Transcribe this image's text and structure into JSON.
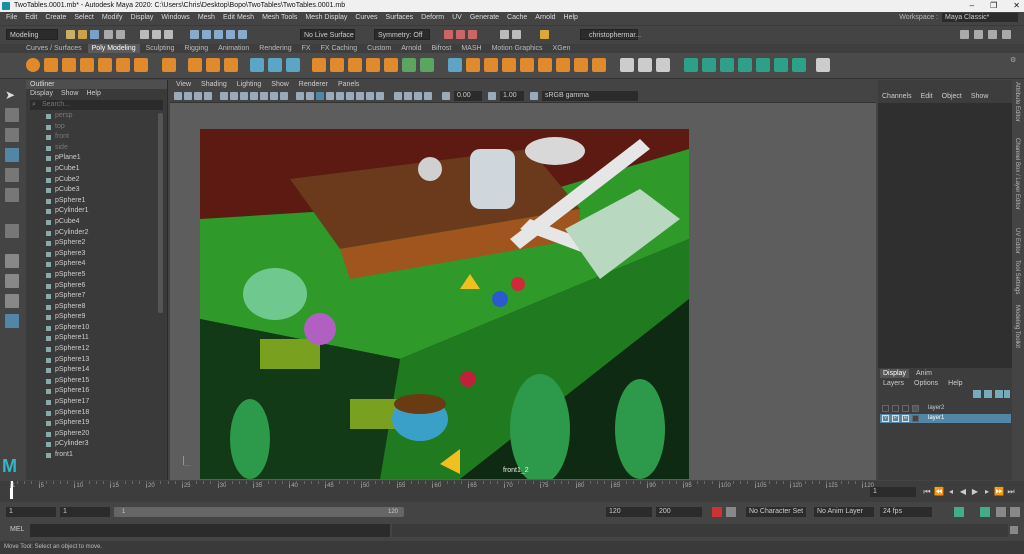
{
  "window": {
    "title": "TwoTables.0001.mb* - Autodesk Maya 2020: C:\\Users\\Chris\\Desktop\\Bopo\\TwoTables\\TwoTables.0001.mb",
    "controls": [
      "–",
      "❐",
      "✕"
    ]
  },
  "menubar": [
    "File",
    "Edit",
    "Create",
    "Select",
    "Modify",
    "Display",
    "Windows",
    "Mesh",
    "Edit Mesh",
    "Mesh Tools",
    "Mesh Display",
    "Curves",
    "Surfaces",
    "Deform",
    "UV",
    "Generate",
    "Cache",
    "Arnold",
    "Help"
  ],
  "workspace": {
    "label": "Workspace :",
    "value": "Maya Classic*"
  },
  "statusline": {
    "mode": "Modeling",
    "live_surface": "No Live Surface",
    "symmetry": "Symmetry: Off",
    "user": "christophermar..."
  },
  "shelf_tabs": [
    "Curves / Surfaces",
    "Poly Modeling",
    "Sculpting",
    "Rigging",
    "Animation",
    "Rendering",
    "FX",
    "FX Caching",
    "Custom",
    "Arnold",
    "Bifrost",
    "MASH",
    "Motion Graphics",
    "XGen"
  ],
  "shelf_active": "Poly Modeling",
  "outliner": {
    "title": "Outliner",
    "menu": [
      "Display",
      "Show",
      "Help"
    ],
    "search_placeholder": "Search...",
    "cameras": [
      "persp",
      "top",
      "front",
      "side"
    ],
    "items": [
      "pPlane1",
      "pCube1",
      "pCube2",
      "pCube3",
      "pSphere1",
      "pCylinder1",
      "pCube4",
      "pCylinder2",
      "pSphere2",
      "pSphere3",
      "pSphere4",
      "pSphere5",
      "pSphere6",
      "pSphere7",
      "pSphere8",
      "pSphere9",
      "pSphere10",
      "pSphere11",
      "pSphere12",
      "pSphere13",
      "pSphere14",
      "pSphere15",
      "pSphere16",
      "pSphere17",
      "pSphere18",
      "pSphere19",
      "pSphere20",
      "pCylinder3",
      "front1"
    ]
  },
  "viewport": {
    "menu": [
      "View",
      "Shading",
      "Lighting",
      "Show",
      "Renderer",
      "Panels"
    ],
    "field1": "0.00",
    "field2": "1.00",
    "colorspace": "sRGB gamma",
    "camera_label": "front1_2"
  },
  "channelbox": {
    "menu": [
      "Channels",
      "Edit",
      "Object",
      "Show"
    ]
  },
  "layers": {
    "tabs": [
      "Display",
      "Anim"
    ],
    "menu": [
      "Layers",
      "Options",
      "Help"
    ],
    "rows": [
      {
        "v": "",
        "p": "",
        "r": "",
        "name": "layer2",
        "selected": false
      },
      {
        "v": "V",
        "p": "P",
        "r": "R",
        "name": "layer1",
        "selected": true
      }
    ]
  },
  "side_tabs": [
    "Attribute Editor",
    "Channel Box / Layer Editor",
    "UV Editor",
    "Tool Settings",
    "Modeling Toolkit"
  ],
  "timeline": {
    "ticks": [
      "1",
      "5",
      "10",
      "15",
      "20",
      "25",
      "30",
      "35",
      "40",
      "45",
      "50",
      "55",
      "60",
      "65",
      "70",
      "75",
      "80",
      "85",
      "90",
      "95",
      "100",
      "105",
      "110",
      "115",
      "120"
    ],
    "current_frame": "1"
  },
  "range": {
    "start": "1",
    "playback_start": "1",
    "slider_start": "1",
    "slider_end": "120",
    "playback_end": "120",
    "end": "200",
    "character_set": "No Character Set",
    "anim_layer": "No Anim Layer",
    "fps": "24 fps"
  },
  "mel": {
    "label": "MEL"
  },
  "help_line": "Move Tool: Select an object to move.",
  "colors": {
    "accent": "#5285a6",
    "selected_layer": "#5285a6",
    "active_tool": "#5285a6"
  }
}
